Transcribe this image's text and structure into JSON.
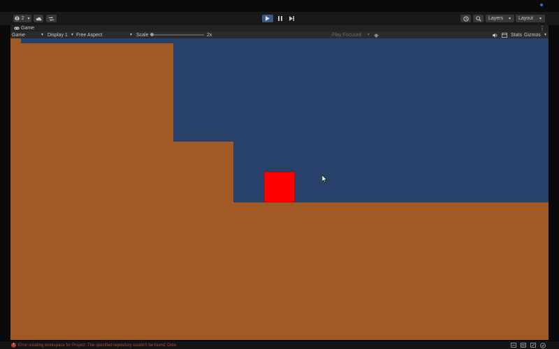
{
  "toolbar": {
    "account_count": "2",
    "layers_label": "Layers",
    "layout_label": "Layout"
  },
  "tab": {
    "title": "Game"
  },
  "game_toolbar": {
    "mode_select": "Game",
    "display_select": "Display 1",
    "aspect_select": "Free Aspect",
    "scale_label": "Scale",
    "scale_value": "2x",
    "scale_position": 0.0,
    "play_focused": "Play Focused",
    "stats_label": "Stats",
    "gizmos_label": "Gizmos"
  },
  "status": {
    "error_message": "Error creating workspace for Project: The specified repository couldn't be found: Oste."
  },
  "colors": {
    "ground": "#a25a24",
    "sky": "#27416a",
    "player": "#ff0000",
    "play_active": "#3a5a86"
  },
  "icons": [
    "account-icon",
    "cloud-icon",
    "collab-icon",
    "play-icon",
    "pause-icon",
    "step-icon",
    "history-icon",
    "search-icon",
    "gamepad-icon",
    "audio-icon",
    "grid-icon",
    "debug-icon",
    "error-icon",
    "layers-status-icon",
    "tasks-icon",
    "settings-icon",
    "check-icon"
  ]
}
